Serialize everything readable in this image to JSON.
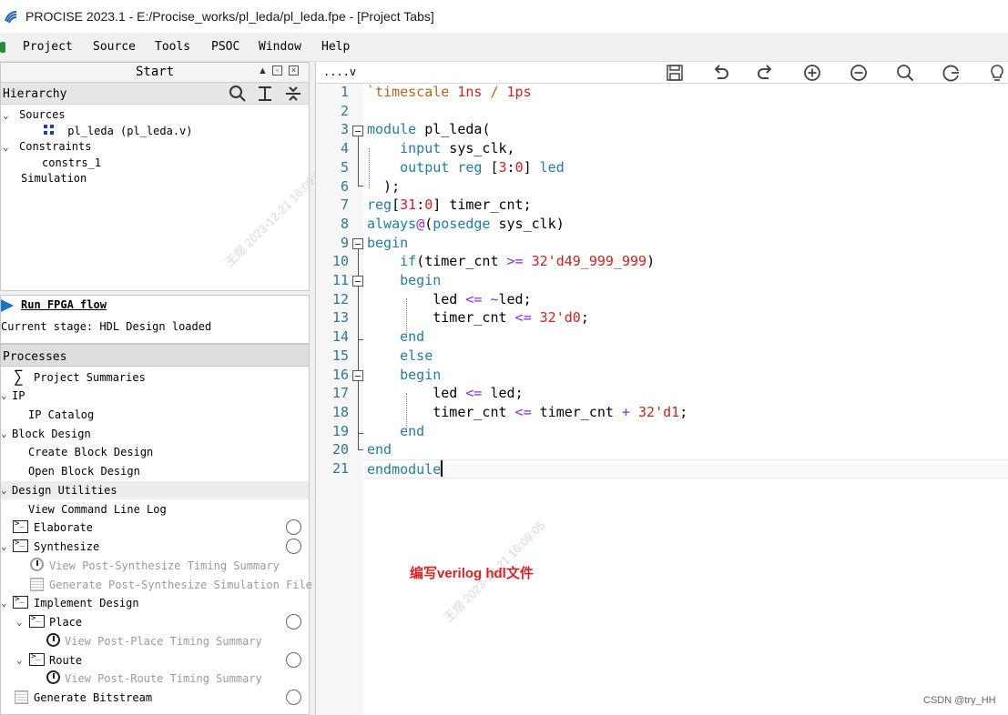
{
  "window": {
    "title": "PROCISE 2023.1  - E:/Procise_works/pl_leda/pl_leda.fpe - [Project Tabs]"
  },
  "menu": [
    "Project",
    "Source",
    "Tools",
    "PSOC",
    "Window",
    "Help"
  ],
  "start_panel": {
    "title": "Start",
    "hierarchy_label": "Hierarchy"
  },
  "hierarchy": {
    "sources": "Sources",
    "source_file": "pl_leda (pl_leda.v)",
    "constraints": "Constraints",
    "constraint_file": "constrs_1",
    "simulation": "Simulation"
  },
  "run": {
    "label": "Run FPGA flow",
    "stage": "Current stage: HDL Design loaded"
  },
  "processes": {
    "title": "Processes",
    "items": [
      "Project Summaries",
      "IP",
      "IP Catalog",
      "Block Design",
      "Create Block Design",
      "Open Block Design",
      "Design Utilities",
      "View Command Line Log",
      "Elaborate",
      "Synthesize",
      "View Post-Synthesize Timing Summary",
      "Generate Post-Synthesize Simulation File",
      "Implement Design",
      "Place",
      "View Post-Place Timing Summary",
      "Route",
      "View Post-Route Timing Summary",
      "Generate Bitstream"
    ]
  },
  "editor": {
    "tab": "....v",
    "line_numbers": [
      "1",
      "2",
      "3",
      "4",
      "5",
      "6",
      "7",
      "8",
      "9",
      "10",
      "11",
      "12",
      "13",
      "14",
      "15",
      "16",
      "17",
      "18",
      "19",
      "20",
      "21"
    ],
    "lines": [
      [
        [
          "dir",
          "`timescale "
        ],
        [
          "num",
          "1ns"
        ],
        [
          "dir",
          " / "
        ],
        [
          "num",
          "1ps"
        ]
      ],
      [],
      [
        [
          "kw",
          "module"
        ],
        [
          "id",
          " pl_leda"
        ],
        [
          "plain",
          "("
        ]
      ],
      [
        [
          "plain",
          "    "
        ],
        [
          "kw",
          "input"
        ],
        [
          "id",
          " sys_clk"
        ],
        [
          "plain",
          ","
        ]
      ],
      [
        [
          "plain",
          "    "
        ],
        [
          "kw",
          "output"
        ],
        [
          "kw",
          " reg"
        ],
        [
          "plain",
          " ["
        ],
        [
          "num",
          "3"
        ],
        [
          "plain",
          ":"
        ],
        [
          "num",
          "0"
        ],
        [
          "plain",
          "] "
        ],
        [
          "kw",
          "led"
        ]
      ],
      [
        [
          "plain",
          "  );"
        ]
      ],
      [
        [
          "kw",
          "reg"
        ],
        [
          "plain",
          "["
        ],
        [
          "num",
          "31"
        ],
        [
          "plain",
          ":"
        ],
        [
          "num",
          "0"
        ],
        [
          "plain",
          "] "
        ],
        [
          "id",
          "timer_cnt"
        ],
        [
          "plain",
          ";"
        ]
      ],
      [
        [
          "kw",
          "always"
        ],
        [
          "op",
          "@"
        ],
        [
          "plain",
          "("
        ],
        [
          "kw",
          "posedge"
        ],
        [
          "id",
          " sys_clk"
        ],
        [
          "plain",
          ")"
        ]
      ],
      [
        [
          "kw",
          "begin"
        ]
      ],
      [
        [
          "plain",
          "    "
        ],
        [
          "kw",
          "if"
        ],
        [
          "plain",
          "("
        ],
        [
          "id",
          "timer_cnt"
        ],
        [
          "op",
          " >= "
        ],
        [
          "num",
          "32'd49_999_999"
        ],
        [
          "plain",
          ")"
        ]
      ],
      [
        [
          "plain",
          "    "
        ],
        [
          "kw",
          "begin"
        ]
      ],
      [
        [
          "plain",
          "        "
        ],
        [
          "id",
          "led"
        ],
        [
          "op",
          " <= "
        ],
        [
          "op",
          "~"
        ],
        [
          "id",
          "led"
        ],
        [
          "plain",
          ";"
        ]
      ],
      [
        [
          "plain",
          "        "
        ],
        [
          "id",
          "timer_cnt"
        ],
        [
          "op",
          " <= "
        ],
        [
          "num",
          "32'd0"
        ],
        [
          "plain",
          ";"
        ]
      ],
      [
        [
          "plain",
          "    "
        ],
        [
          "kw",
          "end"
        ]
      ],
      [
        [
          "plain",
          "    "
        ],
        [
          "kw",
          "else"
        ]
      ],
      [
        [
          "plain",
          "    "
        ],
        [
          "kw",
          "begin"
        ]
      ],
      [
        [
          "plain",
          "        "
        ],
        [
          "id",
          "led"
        ],
        [
          "op",
          " <= "
        ],
        [
          "id",
          "led"
        ],
        [
          "plain",
          ";"
        ]
      ],
      [
        [
          "plain",
          "        "
        ],
        [
          "id",
          "timer_cnt"
        ],
        [
          "op",
          " <= "
        ],
        [
          "id",
          "timer_cnt"
        ],
        [
          "op",
          " + "
        ],
        [
          "num",
          "32'd1"
        ],
        [
          "plain",
          ";"
        ]
      ],
      [
        [
          "plain",
          "    "
        ],
        [
          "kw",
          "end"
        ]
      ],
      [
        [
          "kw",
          "end"
        ]
      ],
      [
        [
          "kw",
          "endmodule"
        ]
      ]
    ]
  },
  "annotation": "编写verilog hdl文件",
  "credit": "CSDN @try_HH",
  "watermark": "王煜  2023-12-21  16:09:05",
  "colors": {
    "keyword": "#1f7ea3",
    "number": "#d02020",
    "annotation": "#e02020",
    "line_number": "#2b7a8f"
  }
}
